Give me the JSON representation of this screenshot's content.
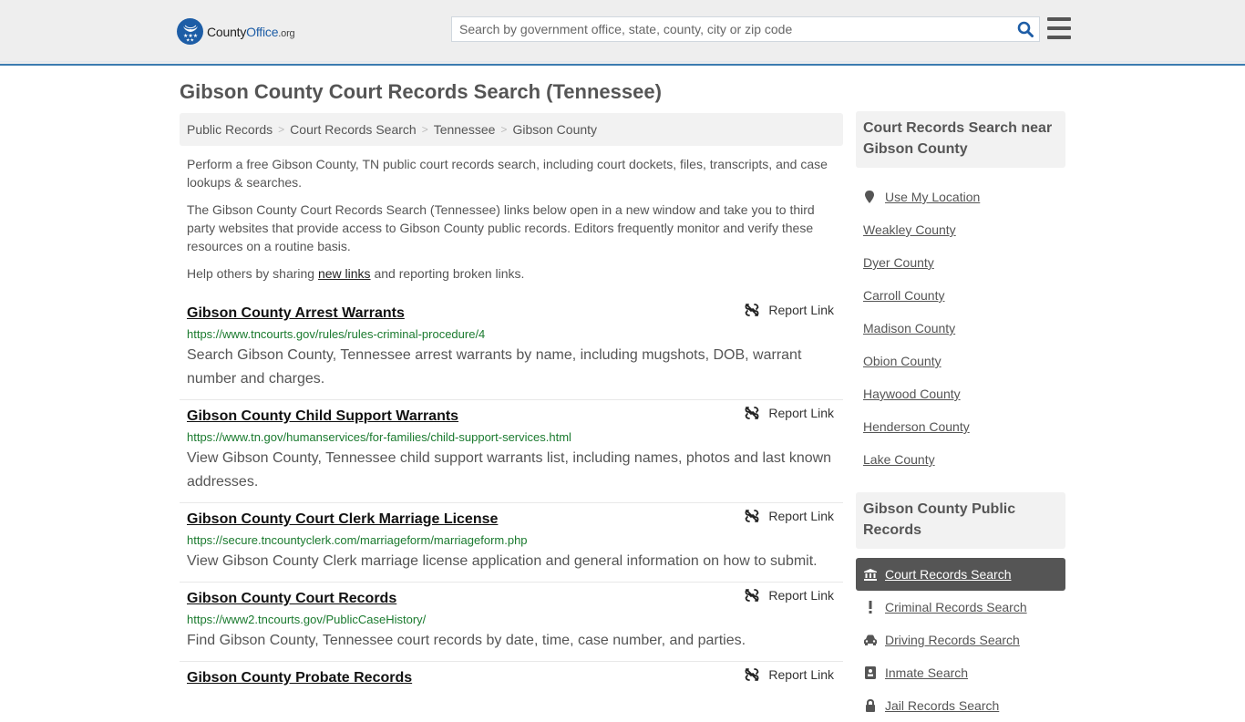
{
  "header": {
    "logo": {
      "part1": "County",
      "part2": "Office",
      "tld": ".org",
      "icon": "eagle-stars-badge-icon"
    },
    "search": {
      "placeholder": "Search by government office, state, county, city or zip code",
      "value": ""
    },
    "menu_icon": "hamburger-menu-icon"
  },
  "colors": {
    "brand_blue": "#1d5da6",
    "header_border": "#3b7bb0",
    "url_green": "#1a7a2e",
    "active_item_bg": "#555555"
  },
  "page": {
    "title": "Gibson County Court Records Search (Tennessee)"
  },
  "breadcrumb": [
    {
      "label": "Public Records"
    },
    {
      "label": "Court Records Search"
    },
    {
      "label": "Tennessee"
    },
    {
      "label": "Gibson County"
    }
  ],
  "breadcrumb_separator": ">",
  "intro": {
    "p1": "Perform a free Gibson County, TN public court records search, including court dockets, files, transcripts, and case lookups & searches.",
    "p2": "The Gibson County Court Records Search (Tennessee) links below open in a new window and take you to third party websites that provide access to Gibson County public records. Editors frequently monitor and verify these resources on a routine basis.",
    "p3_before": "Help others by sharing ",
    "p3_link": "new links",
    "p3_after": " and reporting broken links."
  },
  "report_label": "Report Link",
  "results": [
    {
      "title": "Gibson County Arrest Warrants",
      "url": "https://www.tncourts.gov/rules/rules-criminal-procedure/4",
      "description": "Search Gibson County, Tennessee arrest warrants by name, including mugshots, DOB, warrant number and charges."
    },
    {
      "title": "Gibson County Child Support Warrants",
      "url": "https://www.tn.gov/humanservices/for-families/child-support-services.html",
      "description": "View Gibson County, Tennessee child support warrants list, including names, photos and last known addresses."
    },
    {
      "title": "Gibson County Court Clerk Marriage License",
      "url": "https://secure.tncountyclerk.com/marriageform/marriageform.php",
      "description": "View Gibson County Clerk marriage license application and general information on how to submit."
    },
    {
      "title": "Gibson County Court Records",
      "url": "https://www2.tncourts.gov/PublicCaseHistory/",
      "description": "Find Gibson County, Tennessee court records by date, time, case number, and parties."
    },
    {
      "title": "Gibson County Probate Records",
      "url": "",
      "description": ""
    }
  ],
  "sidebar": {
    "near_title": "Court Records Search near Gibson County",
    "use_location": "Use My Location",
    "nearby": [
      "Weakley County",
      "Dyer County",
      "Carroll County",
      "Madison County",
      "Obion County",
      "Haywood County",
      "Henderson County",
      "Lake County"
    ],
    "records_title": "Gibson County Public Records",
    "records": [
      {
        "label": "Court Records Search",
        "icon": "courthouse-icon",
        "active": true
      },
      {
        "label": "Criminal Records Search",
        "icon": "exclamation-icon",
        "active": false
      },
      {
        "label": "Driving Records Search",
        "icon": "car-icon",
        "active": false
      },
      {
        "label": "Inmate Search",
        "icon": "id-badge-icon",
        "active": false
      },
      {
        "label": "Jail Records Search",
        "icon": "lock-icon",
        "active": false
      }
    ]
  }
}
